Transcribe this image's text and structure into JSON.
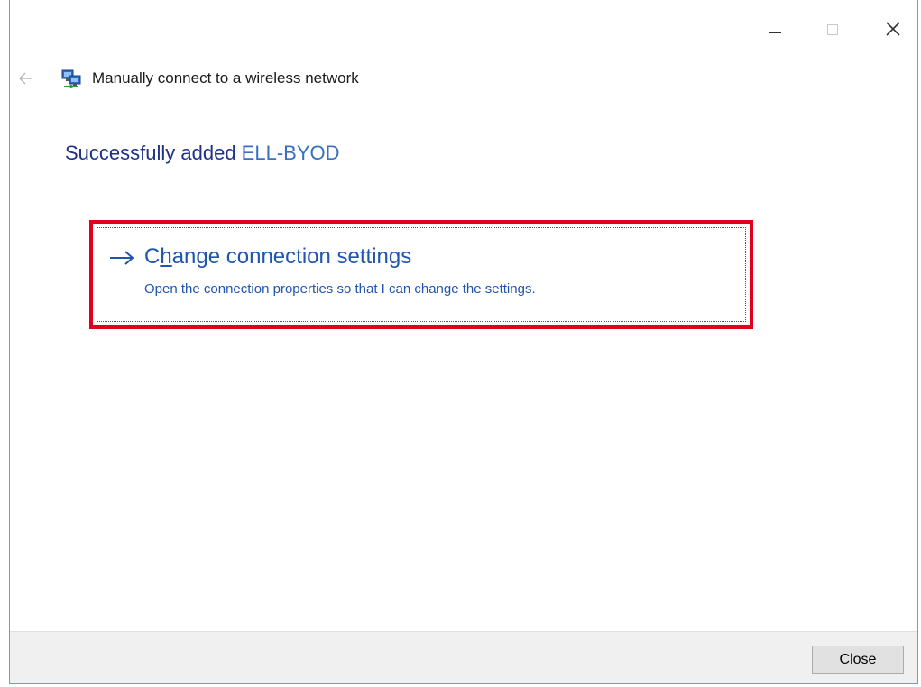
{
  "window": {
    "controls": {
      "minimize": "minimize",
      "maximize": "maximize",
      "close": "close"
    }
  },
  "nav": {
    "back_icon": "back-arrow-icon",
    "wizard_icon": "wireless-network-icon",
    "title": "Manually connect to a wireless network"
  },
  "main": {
    "heading_prefix": "Successfully added ",
    "network_name": "ELL-BYOD"
  },
  "command_link": {
    "title_before": "C",
    "title_accel": "h",
    "title_after": "ange connection settings",
    "description": "Open the connection properties so that I can change the settings.",
    "icon": "right-arrow-icon"
  },
  "footer": {
    "close_label": "Close"
  },
  "colors": {
    "heading": "#1e3287",
    "network_name": "#3a6fc4",
    "link": "#1f56ad",
    "highlight": "#e0001b",
    "window_border": "#6b9fd4",
    "footer_bg": "#f0f0f0"
  }
}
